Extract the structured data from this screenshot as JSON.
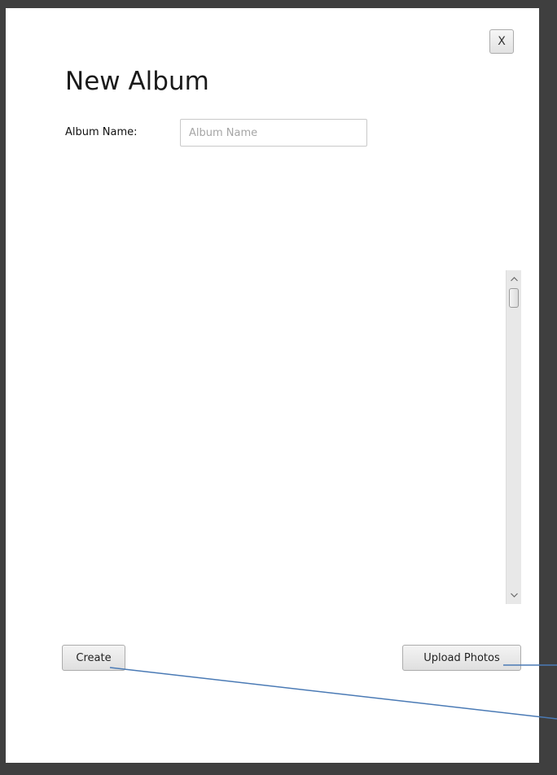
{
  "dialog": {
    "close_label": "X",
    "title": "New Album",
    "album_name_label": "Album Name:",
    "album_name_input": {
      "value": "",
      "placeholder": "Album Name"
    },
    "scrollbar": {
      "up_icon": "chevron-up-icon",
      "down_icon": "chevron-down-icon",
      "position": 0
    },
    "create_label": "Create",
    "upload_label": "Upload Photos"
  },
  "colors": {
    "backdrop": "#3f3f3f",
    "dialog_background": "#ffffff",
    "annotation_line": "#4a7ab5"
  }
}
